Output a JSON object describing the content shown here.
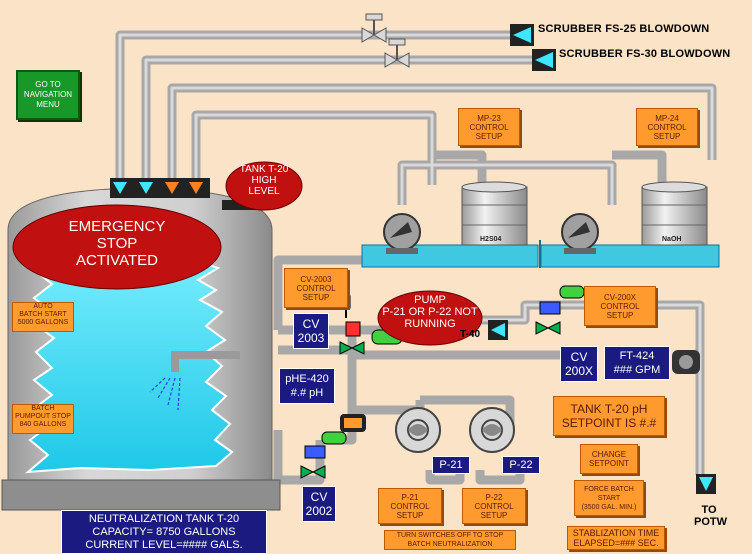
{
  "nav_button": "GO TO\nNAVIGATION\nMENU",
  "scrubber_fs25": "SCRUBBER FS-25 BLOWDOWN",
  "scrubber_fs30": "SCRUBBER FS-30 BLOWDOWN",
  "mp23": "MP-23\nCONTROL\nSETUP",
  "mp24": "MP-24\nCONTROL\nSETUP",
  "tank_high_level": "TANK T-20\nHIGH\nLEVEL",
  "emergency_stop": "EMERGENCY\nSTOP\nACTIVATED",
  "h2so4": "H2S04",
  "naoh": "NaOH",
  "cv2003_setup": "CV-2003\nCONTROL\nSETUP",
  "pump_not_running": "PUMP\nP-21 OR P-22 NOT\nRUNNING",
  "cv200x_setup": "CV-200X\nCONTROL\nSETUP",
  "auto_batch_start": "AUTO\nBATCH START\n5000 GALLONS",
  "batch_pumpout_stop": "BATCH\nPUMPOUT STOP\n840 GALLONS",
  "cv2003_label": "CV\n2003",
  "t40_label": "T-40",
  "cv200x_label": "CV\n200X",
  "ft424": "FT-424\n### GPM",
  "phe420": "pHE-420\n#.# pH",
  "tank_ph_setpoint": "TANK T-20 pH\nSETPOINT IS #.#",
  "change_setpoint": "CHANGE\nSETPOINT",
  "p21": "P-21",
  "p22": "P-22",
  "force_batch": "FORCE BATCH\nSTART\n(3500 GAL. MIN.)",
  "cv2002_label": "CV\n2002",
  "p21_setup": "P-21\nCONTROL\nSETUP",
  "p22_setup": "P-22\nCONTROL\nSETUP",
  "to_potw": "TO\nPOTW",
  "turn_switches": "TURN SWITCHES OFF TO STOP\nBATCH NEUTRALIZATION",
  "stabilization": "STABLIZATION TIME\nELAPSED=### SEC.",
  "tank_info": "NEUTRALIZATION TANK T-20\nCAPACITY= 8750 GALLONS\nCURRENT LEVEL=#### GALS."
}
